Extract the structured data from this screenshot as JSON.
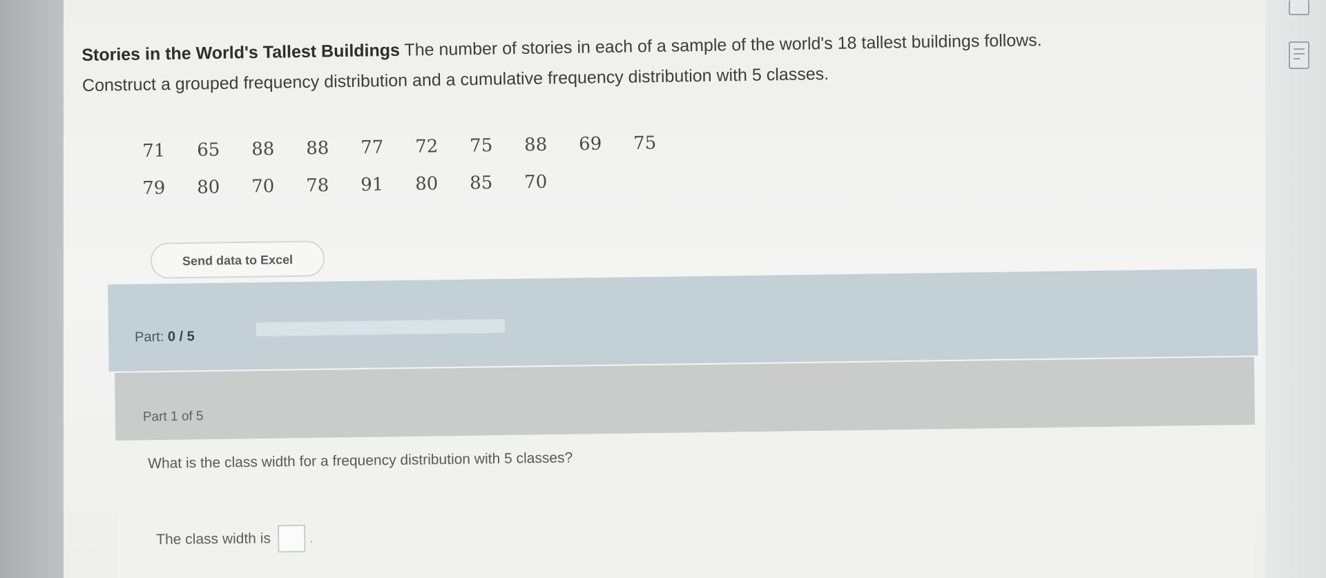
{
  "problem": {
    "title": "Stories in the World's Tallest Buildings",
    "intro": " The number of stories in each of a sample of the world's 18 tallest buildings follows.",
    "instruction": "Construct a grouped frequency distribution and a cumulative frequency distribution with 5 classes."
  },
  "data_rows": [
    [
      "71",
      "65",
      "88",
      "88",
      "77",
      "72",
      "75",
      "88",
      "69",
      "75"
    ],
    [
      "79",
      "80",
      "70",
      "78",
      "91",
      "80",
      "85",
      "70"
    ]
  ],
  "excel_button_label": "Send data to Excel",
  "progress": {
    "label": "Part:",
    "value": "0 / 5",
    "fraction": 0
  },
  "part_header": "Part 1 of 5",
  "question": "What is the class width for a frequency distribution with 5 classes?",
  "answer_prompt": "The class width is",
  "answer_value": "",
  "answer_suffix": ".",
  "icons": {
    "top_right": "video-icon",
    "sheet": "worksheet-icon"
  }
}
